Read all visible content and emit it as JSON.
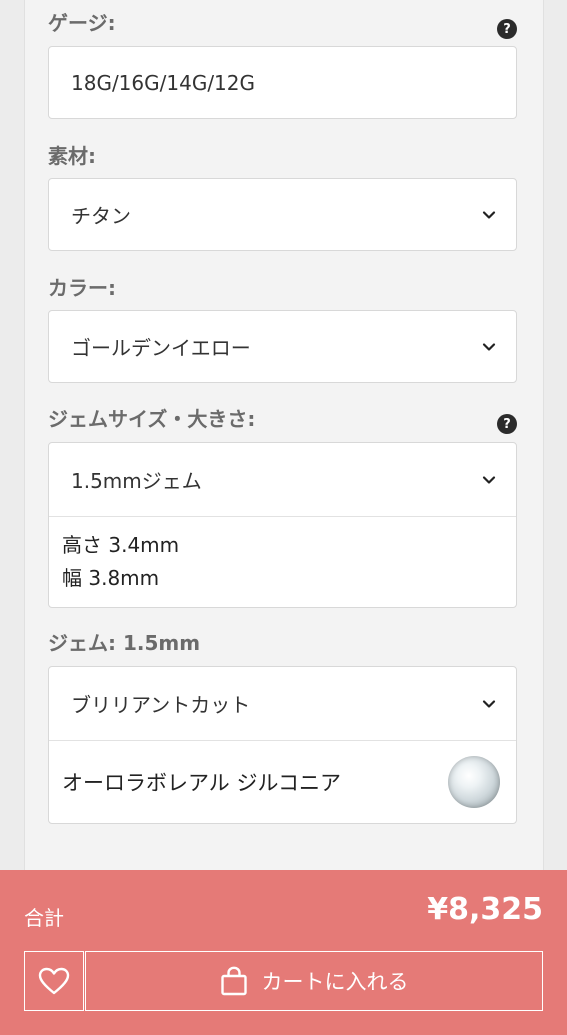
{
  "gauge": {
    "label": "ゲージ:",
    "help": "?",
    "value": "18G/16G/14G/12G"
  },
  "material": {
    "label": "素材:",
    "value": "チタン"
  },
  "color": {
    "label": "カラー:",
    "value": "ゴールデンイエロー"
  },
  "gem_size": {
    "label": "ジェムサイズ・大きさ:",
    "help": "?",
    "value": "1.5mmジェム",
    "height": "高さ 3.4mm",
    "width": "幅 3.8mm"
  },
  "gem": {
    "label": "ジェム: 1.5mm",
    "cut": "ブリリアントカット",
    "name": "オーロラボレアル ジルコニア"
  },
  "footer": {
    "total_label": "合計",
    "total_price": "¥8,325",
    "cart_label": "カートに入れる"
  }
}
